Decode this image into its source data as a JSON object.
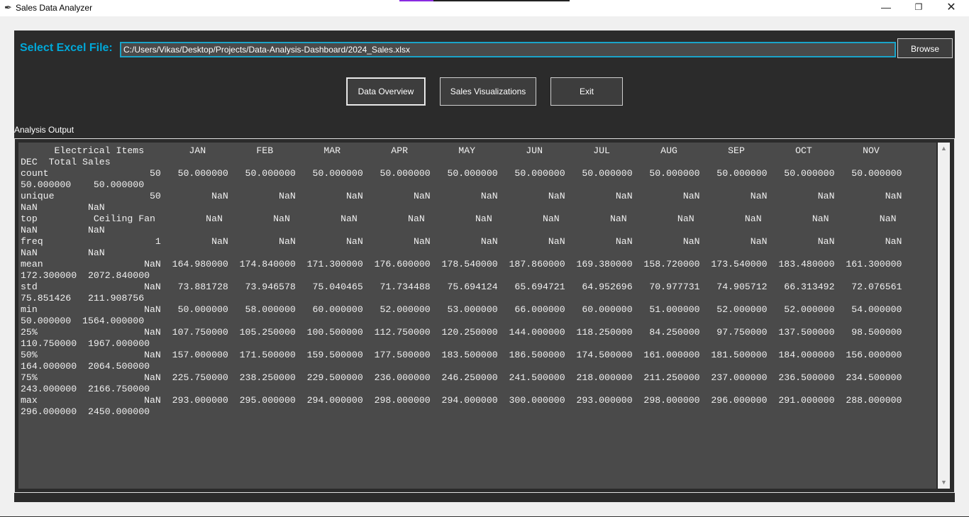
{
  "window": {
    "title": "Sales Data Analyzer",
    "app_icon": "feather-icon",
    "minimize_glyph": "—",
    "maximize_glyph": "❐",
    "close_glyph": "✕"
  },
  "file_select": {
    "label": "Select Excel File:",
    "path": "C:/Users/Vikas/Desktop/Projects/Data-Analysis-Dashboard/2024_Sales.xlsx",
    "browse_label": "Browse"
  },
  "actions": {
    "overview_label": "Data Overview",
    "visualizations_label": "Sales Visualizations",
    "exit_label": "Exit"
  },
  "output": {
    "label": "Analysis Output",
    "lines": [
      "      Electrical Items        JAN         FEB         MAR         APR         MAY         JUN         JUL         AUG         SEP         OCT         NOV",
      "DEC  Total Sales",
      "count                  50   50.000000   50.000000   50.000000   50.000000   50.000000   50.000000   50.000000   50.000000   50.000000   50.000000   50.000000",
      "50.000000    50.000000",
      "unique                 50         NaN         NaN         NaN         NaN         NaN         NaN         NaN         NaN         NaN         NaN         NaN",
      "NaN         NaN",
      "top          Ceiling Fan         NaN         NaN         NaN         NaN         NaN         NaN         NaN         NaN         NaN         NaN         NaN",
      "NaN         NaN",
      "freq                    1         NaN         NaN         NaN         NaN         NaN         NaN         NaN         NaN         NaN         NaN         NaN",
      "NaN         NaN",
      "mean                  NaN  164.980000  174.840000  171.300000  176.600000  178.540000  187.860000  169.380000  158.720000  173.540000  183.480000  161.300000",
      "172.300000  2072.840000",
      "std                   NaN   73.881728   73.946578   75.040465   71.734488   75.694124   65.694721   64.952696   70.977731   74.905712   66.313492   72.076561",
      "75.851426   211.908756",
      "min                   NaN   50.000000   58.000000   60.000000   52.000000   53.000000   66.000000   60.000000   51.000000   52.000000   52.000000   54.000000",
      "50.000000  1564.000000",
      "25%                   NaN  107.750000  105.250000  100.500000  112.750000  120.250000  144.000000  118.250000   84.250000   97.750000  137.500000   98.500000",
      "110.750000  1967.000000",
      "50%                   NaN  157.000000  171.500000  159.500000  177.500000  183.500000  186.500000  174.500000  161.000000  181.500000  184.000000  156.000000",
      "164.000000  2064.500000",
      "75%                   NaN  225.750000  238.250000  229.500000  236.000000  246.250000  241.500000  218.000000  211.250000  237.000000  236.500000  234.500000",
      "243.000000  2166.750000",
      "max                   NaN  293.000000  295.000000  294.000000  298.000000  294.000000  300.000000  293.000000  298.000000  296.000000  291.000000  288.000000",
      "296.000000  2450.000000"
    ],
    "scroll_up_glyph": "▲",
    "scroll_down_glyph": "▼"
  },
  "colors": {
    "accent": "#00a8d8",
    "panel": "#2b2b2b",
    "text_area": "#4a4a4a"
  }
}
